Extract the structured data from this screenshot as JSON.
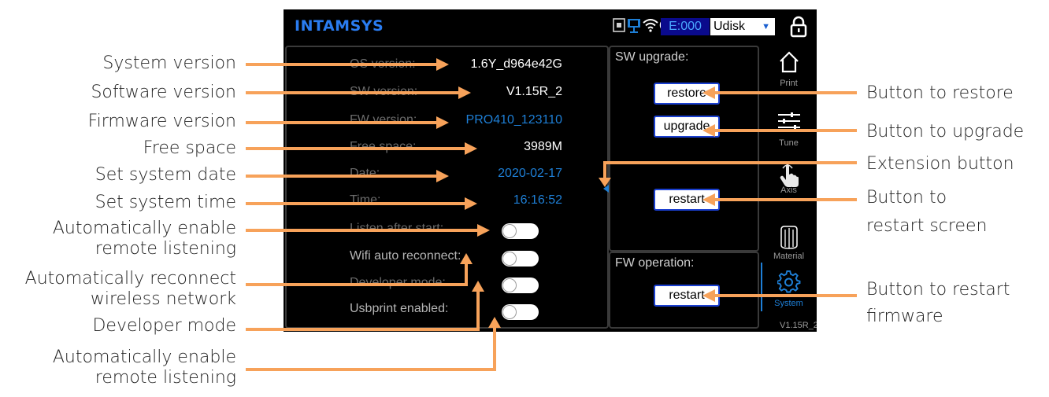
{
  "screen": {
    "brand": "INTAMSYS",
    "status": {
      "icons": [
        "usb-device-icon",
        "network-monitor-icon",
        "wifi-icon",
        "globe-icon"
      ],
      "error_count": "E:000",
      "storage": {
        "selected": "Udisk"
      },
      "lock_icon": "lock-icon"
    },
    "info": {
      "os_label": "OS version:",
      "os_value": "1.6Y_d964e42G",
      "sw_label": "SW version:",
      "sw_value": "V1.15R_2",
      "fw_label": "FW version:",
      "fw_value": "PRO410_123110",
      "free_label": "Free space:",
      "free_value": "3989M",
      "date_label": "Date:",
      "date_value": "2020-02-17",
      "time_label": "Time:",
      "time_value": "16:16:52",
      "toggles": [
        {
          "label": "Listen after start:",
          "on": false
        },
        {
          "label": "Wifi auto reconnect:",
          "on": false
        },
        {
          "label": "Developer mode:",
          "on": false
        },
        {
          "label": "Usbprint enabled:",
          "on": false
        }
      ]
    },
    "sw_upgrade": {
      "title": "SW upgrade:",
      "restore": "restore",
      "upgrade": "upgrade",
      "restart": "restart"
    },
    "fw_operation": {
      "title": "FW operation:",
      "restart": "restart"
    },
    "nav": [
      {
        "label": "Print",
        "icon": "home-icon"
      },
      {
        "label": "Tune",
        "icon": "sliders-icon"
      },
      {
        "label": "Axis",
        "icon": "hand-pointer-icon"
      },
      {
        "label": "Material",
        "icon": "filament-spool-icon"
      },
      {
        "label": "System",
        "icon": "gear-icon",
        "active": true
      }
    ],
    "nav_version": "V1.15R_2"
  },
  "callouts": {
    "left": [
      "System version",
      "Software version",
      "Firmware version",
      "Free space",
      "Set system date",
      "Set system time",
      "Automatically enable\nremote listening",
      "Automatically reconnect\nwireless network",
      "Developer mode",
      "Automatically enable\nremote listening"
    ],
    "right": [
      "Button to restore",
      "Button to upgrade",
      "Extension button",
      "Button to\nrestart screen",
      "Button to restart\nfirmware"
    ]
  },
  "colors": {
    "callout_line": "#f7a25a",
    "accent_blue": "#1e7fd6",
    "brand_blue": "#2a7cf0"
  }
}
